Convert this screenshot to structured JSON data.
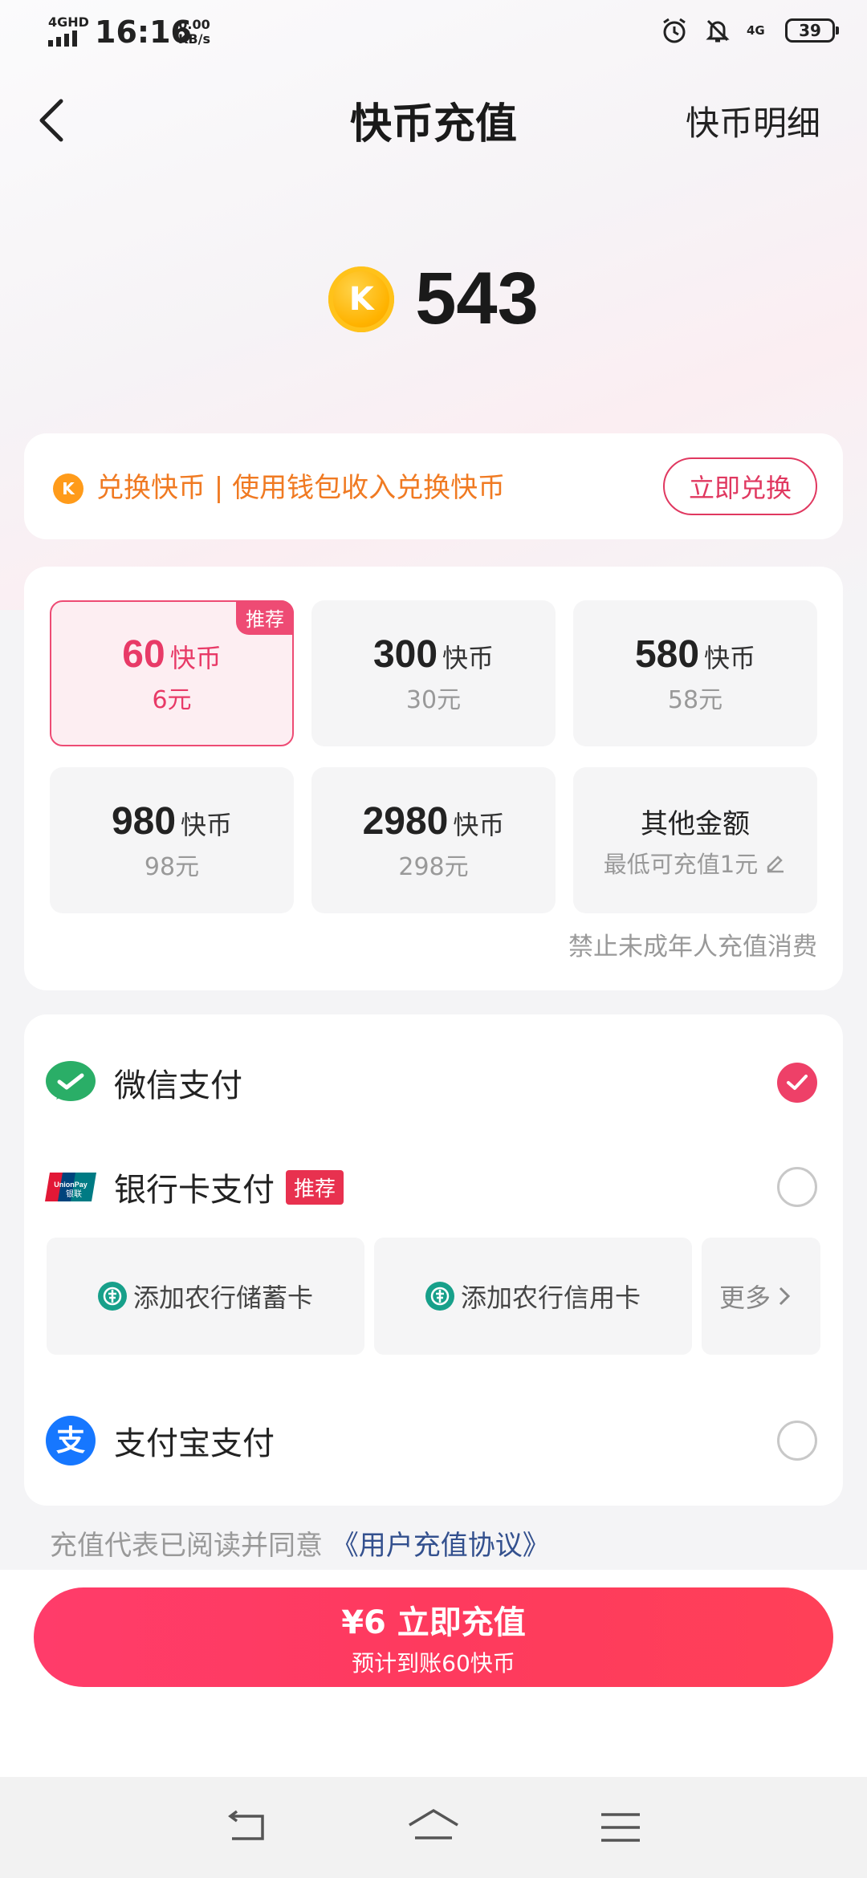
{
  "status_bar": {
    "network": "4GHD",
    "time": "16:16",
    "speed_value": "0.00",
    "speed_unit": "KB/s",
    "signal_4g": "4G",
    "battery": "39",
    "icons": [
      "alarm-icon",
      "mute-bell-icon"
    ]
  },
  "header": {
    "title": "快币充值",
    "detail_link": "快币明细"
  },
  "balance": {
    "coin_letter": "K",
    "amount": "543"
  },
  "exchange": {
    "coin_letter": "K",
    "text": "兑换快币 | 使用钱包收入兑换快币",
    "button": "立即兑换"
  },
  "packages": {
    "items": [
      {
        "amount": "60",
        "unit": "快币",
        "price": "6元",
        "badge": "推荐",
        "selected": true
      },
      {
        "amount": "300",
        "unit": "快币",
        "price": "30元"
      },
      {
        "amount": "580",
        "unit": "快币",
        "price": "58元"
      },
      {
        "amount": "980",
        "unit": "快币",
        "price": "98元"
      },
      {
        "amount": "2980",
        "unit": "快币",
        "price": "298元"
      }
    ],
    "other": {
      "label": "其他金额",
      "hint": "最低可充值1元"
    },
    "minor_note": "禁止未成年人充值消费"
  },
  "payment": {
    "wechat": {
      "label": "微信支付",
      "selected": true
    },
    "bank": {
      "label": "银行卡支付",
      "badge": "推荐",
      "selected": false,
      "icon_text": "UnionPay 银联"
    },
    "bank_cards": [
      {
        "label": "添加农行储蓄卡"
      },
      {
        "label": "添加农行信用卡"
      }
    ],
    "more": "更多",
    "alipay": {
      "label": "支付宝支付",
      "selected": false,
      "icon_text": "支"
    }
  },
  "agreement": {
    "text": "充值代表已阅读并同意",
    "link": "《用户充值协议》"
  },
  "cta": {
    "main": "¥6 立即充值",
    "sub": "预计到账60快币"
  },
  "colors": {
    "accent": "#ee4068",
    "orange": "#f07a22",
    "wechat": "#2aae67",
    "alipay": "#1677ff"
  }
}
